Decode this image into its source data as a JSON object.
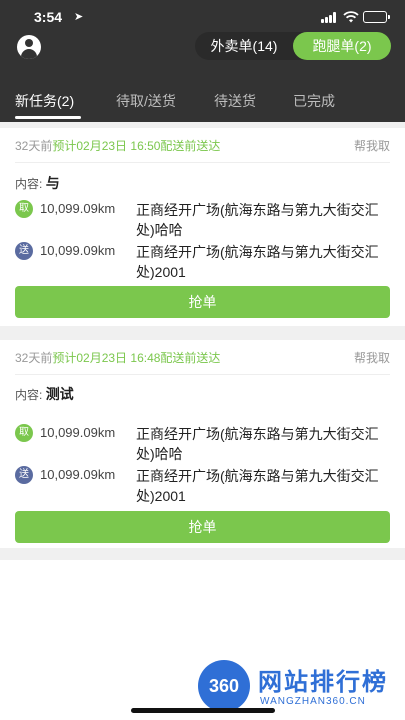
{
  "status_bar": {
    "time": "3:54"
  },
  "header": {
    "segments": [
      {
        "label": "外卖单(14)"
      },
      {
        "label": "跑腿单(2)"
      }
    ],
    "active_segment": 1
  },
  "tabs": [
    {
      "label": "新任务(2)"
    },
    {
      "label": "待取/送货"
    },
    {
      "label": "待送货"
    },
    {
      "label": "已完成"
    }
  ],
  "orders": [
    {
      "ago": "32天前",
      "eta": "预计02月23日 16:50配送前送达",
      "help_label": "帮我取",
      "content_label": "内容:",
      "content_value": "与",
      "pickup_badge": "取",
      "pickup_distance": "10,099.09km",
      "pickup_address": "正商经开广场(航海东路与第九大街交汇处)哈哈",
      "delivery_badge": "送",
      "delivery_distance": "10,099.09km",
      "delivery_address": "正商经开广场(航海东路与第九大街交汇处)2001",
      "button_label": "抢单"
    },
    {
      "ago": "32天前",
      "eta": "预计02月23日 16:48配送前送达",
      "help_label": "帮我取",
      "content_label": "内容:",
      "content_value": "测试",
      "pickup_badge": "取",
      "pickup_distance": "10,099.09km",
      "pickup_address": "正商经开广场(航海东路与第九大街交汇处)哈哈",
      "delivery_badge": "送",
      "delivery_distance": "10,099.09km",
      "delivery_address": "正商经开广场(航海东路与第九大街交汇处)2001",
      "button_label": "抢单"
    }
  ],
  "watermark": {
    "badge": "360",
    "title": "网站排行榜",
    "subtitle": "WANGZHAN360.CN"
  },
  "colors": {
    "accent": "#7bc74d",
    "header_bg": "#333333",
    "send_badge": "#5a6ba0",
    "watermark": "#2f6fd6"
  },
  "icons": {
    "avatar": "user-avatar-icon",
    "location": "location-arrow-icon",
    "signal": "cellular-signal-icon",
    "wifi": "wifi-icon",
    "battery": "battery-icon"
  }
}
